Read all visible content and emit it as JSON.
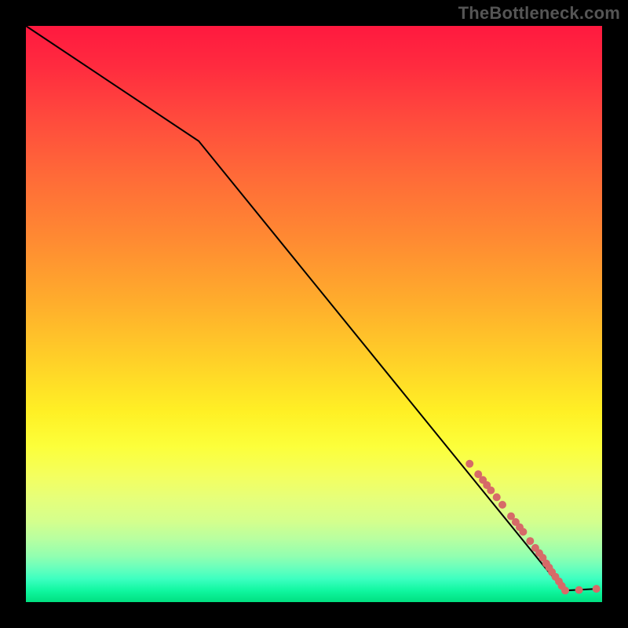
{
  "attribution": "TheBottleneck.com",
  "chart_data": {
    "type": "line",
    "title": "",
    "xlabel": "",
    "ylabel": "",
    "xlim": [
      0,
      100
    ],
    "ylim": [
      0,
      100
    ],
    "grid": false,
    "legend": false,
    "line": {
      "x": [
        0,
        30,
        90.5,
        93.5,
        99
      ],
      "y": [
        100,
        80,
        5.5,
        2.0,
        2.3
      ],
      "color": "#000000",
      "width": 2
    },
    "markers": {
      "color": "#d66a68",
      "radius": 5,
      "points": [
        {
          "x": 77.0,
          "y": 24.0
        },
        {
          "x": 78.5,
          "y": 22.2
        },
        {
          "x": 79.3,
          "y": 21.2
        },
        {
          "x": 80.0,
          "y": 20.3
        },
        {
          "x": 80.7,
          "y": 19.4
        },
        {
          "x": 81.7,
          "y": 18.2
        },
        {
          "x": 82.7,
          "y": 16.9
        },
        {
          "x": 84.2,
          "y": 14.9
        },
        {
          "x": 85.0,
          "y": 13.9
        },
        {
          "x": 85.7,
          "y": 13.0
        },
        {
          "x": 86.3,
          "y": 12.2
        },
        {
          "x": 87.5,
          "y": 10.6
        },
        {
          "x": 88.4,
          "y": 9.4
        },
        {
          "x": 89.1,
          "y": 8.5
        },
        {
          "x": 89.7,
          "y": 7.7
        },
        {
          "x": 90.3,
          "y": 6.7
        },
        {
          "x": 90.8,
          "y": 6.0
        },
        {
          "x": 91.3,
          "y": 5.2
        },
        {
          "x": 91.9,
          "y": 4.4
        },
        {
          "x": 92.5,
          "y": 3.6
        },
        {
          "x": 93.0,
          "y": 2.8
        },
        {
          "x": 93.6,
          "y": 2.0
        },
        {
          "x": 96.0,
          "y": 2.1
        },
        {
          "x": 99.0,
          "y": 2.3
        }
      ]
    }
  }
}
